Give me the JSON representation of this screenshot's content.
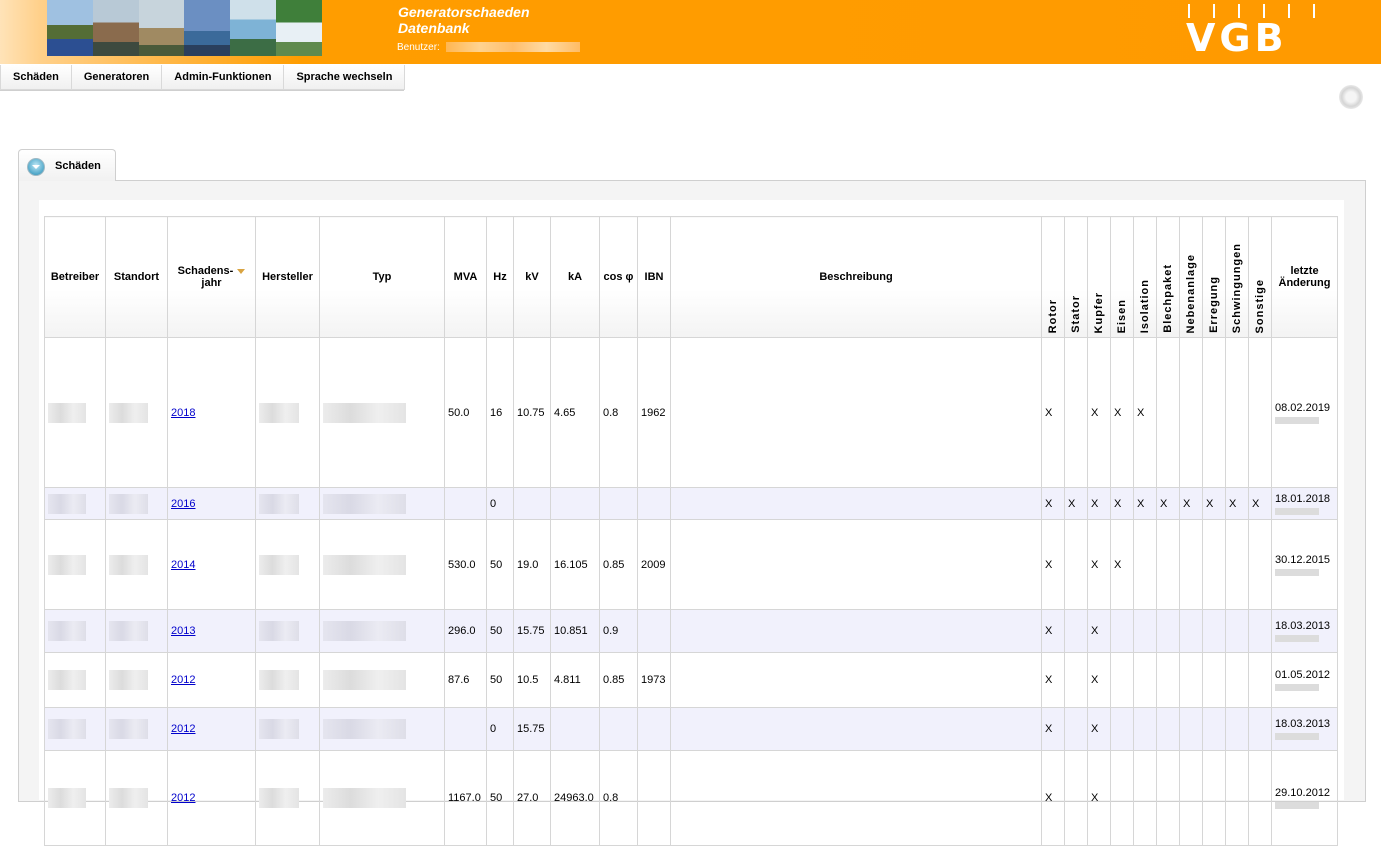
{
  "header": {
    "title_line1": "Generatorschaeden",
    "title_line2": "Datenbank",
    "user_label": "Benutzer:",
    "logo_text": "VGB"
  },
  "menu": {
    "items": [
      {
        "label": "Schäden"
      },
      {
        "label": "Generatoren"
      },
      {
        "label": "Admin-Funktionen"
      },
      {
        "label": "Sprache wechseln"
      }
    ]
  },
  "tab": {
    "label": "Schäden"
  },
  "table": {
    "headers": {
      "betreiber": "Betreiber",
      "standort": "Standort",
      "schadensjahr_1": "Schadens-",
      "schadensjahr_2": "jahr",
      "hersteller": "Hersteller",
      "typ": "Typ",
      "mva": "MVA",
      "hz": "Hz",
      "kv": "kV",
      "ka": "kA",
      "cosphi": "cos φ",
      "ibn": "IBN",
      "beschreibung": "Beschreibung",
      "rotor": "Rotor",
      "stator": "Stator",
      "kupfer": "Kupfer",
      "eisen": "Eisen",
      "isolation": "Isolation",
      "blechpaket": "Blechpaket",
      "nebenanlage": "Nebenanlage",
      "erregung": "Erregung",
      "schwingungen": "Schwingungen",
      "sonstige": "Sonstige",
      "letzte_1": "letzte",
      "letzte_2": "Änderung"
    },
    "rows": [
      {
        "jahr": "2018",
        "mva": "50.0",
        "hz": "16",
        "kv": "10.75",
        "ka": "4.65",
        "cos": "0.8",
        "ibn": "1962",
        "rotor": "X",
        "stator": "",
        "kupfer": "X",
        "eisen": "X",
        "isolation": "X",
        "blechpaket": "",
        "nebenanlage": "",
        "erregung": "",
        "schwingungen": "",
        "sonstige": "",
        "datum": "08.02.2019"
      },
      {
        "jahr": "2016",
        "mva": "",
        "hz": "0",
        "kv": "",
        "ka": "",
        "cos": "",
        "ibn": "",
        "rotor": "X",
        "stator": "X",
        "kupfer": "X",
        "eisen": "X",
        "isolation": "X",
        "blechpaket": "X",
        "nebenanlage": "X",
        "erregung": "X",
        "schwingungen": "X",
        "sonstige": "X",
        "datum": "18.01.2018"
      },
      {
        "jahr": "2014",
        "mva": "530.0",
        "hz": "50",
        "kv": "19.0",
        "ka": "16.105",
        "cos": "0.85",
        "ibn": "2009",
        "rotor": "X",
        "stator": "",
        "kupfer": "X",
        "eisen": "X",
        "isolation": "",
        "blechpaket": "",
        "nebenanlage": "",
        "erregung": "",
        "schwingungen": "",
        "sonstige": "",
        "datum": "30.12.2015"
      },
      {
        "jahr": "2013",
        "mva": "296.0",
        "hz": "50",
        "kv": "15.75",
        "ka": "10.851",
        "cos": "0.9",
        "ibn": "",
        "rotor": "X",
        "stator": "",
        "kupfer": "X",
        "eisen": "",
        "isolation": "",
        "blechpaket": "",
        "nebenanlage": "",
        "erregung": "",
        "schwingungen": "",
        "sonstige": "",
        "datum": "18.03.2013"
      },
      {
        "jahr": "2012",
        "mva": "87.6",
        "hz": "50",
        "kv": "10.5",
        "ka": "4.811",
        "cos": "0.85",
        "ibn": "1973",
        "rotor": "X",
        "stator": "",
        "kupfer": "X",
        "eisen": "",
        "isolation": "",
        "blechpaket": "",
        "nebenanlage": "",
        "erregung": "",
        "schwingungen": "",
        "sonstige": "",
        "datum": "01.05.2012"
      },
      {
        "jahr": "2012",
        "mva": "",
        "hz": "0",
        "kv": "15.75",
        "ka": "",
        "cos": "",
        "ibn": "",
        "rotor": "X",
        "stator": "",
        "kupfer": "X",
        "eisen": "",
        "isolation": "",
        "blechpaket": "",
        "nebenanlage": "",
        "erregung": "",
        "schwingungen": "",
        "sonstige": "",
        "datum": "18.03.2013"
      },
      {
        "jahr": "2012",
        "mva": "1167.0",
        "hz": "50",
        "kv": "27.0",
        "ka": "24963.0",
        "cos": "0.8",
        "ibn": "",
        "rotor": "X",
        "stator": "",
        "kupfer": "X",
        "eisen": "",
        "isolation": "",
        "blechpaket": "",
        "nebenanlage": "",
        "erregung": "",
        "schwingungen": "",
        "sonstige": "",
        "datum": "29.10.2012"
      }
    ]
  }
}
